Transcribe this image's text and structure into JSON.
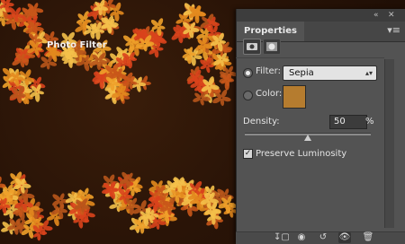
{
  "panel": {
    "tab_label": "Properties",
    "title": "Photo Filter",
    "filter_label": "Filter:",
    "filter_value": "Sepia",
    "color_label": "Color:",
    "color_value": "#B57C2F",
    "density_label": "Density:",
    "density_value": "50",
    "density_unit": "%",
    "density_level": 0.5,
    "preserve_label": "Preserve Luminosity",
    "preserve_checked": true,
    "top_controls": [
      "collapse-icon",
      "close-icon"
    ],
    "bottom_icons": [
      "clip-to-layer-icon",
      "view-previous-state-icon",
      "reset-icon",
      "toggle-visibility-icon",
      "delete-icon"
    ]
  },
  "colors": {
    "canvas_bg": "#2A1608",
    "panel_bg": "#535353",
    "accent_orange": "#E0802A"
  }
}
